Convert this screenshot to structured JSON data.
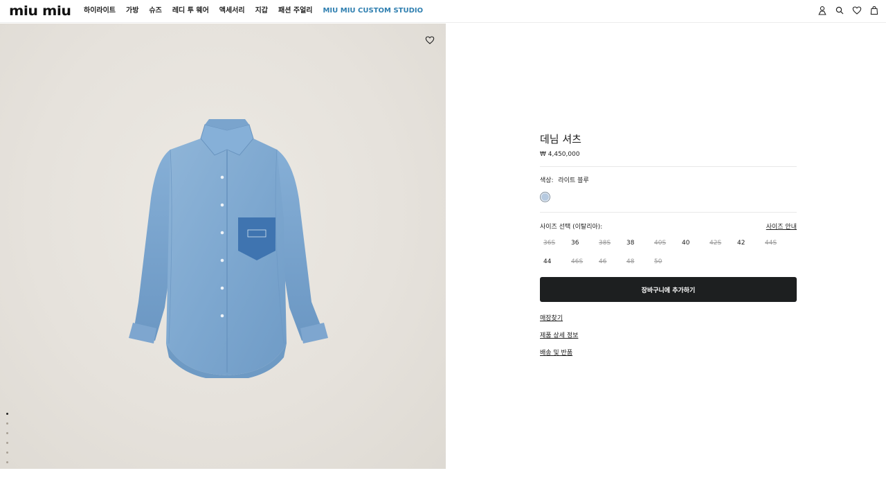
{
  "brand": {
    "logo": "miu miu"
  },
  "nav": [
    "하이라이트",
    "가방",
    "슈즈",
    "레디 투 웨어",
    "액세서리",
    "지갑",
    "패션 주얼리",
    "MIU MIU CUSTOM STUDIO"
  ],
  "header_icons": [
    "user-icon",
    "search-icon",
    "heart-icon",
    "bag-icon"
  ],
  "product": {
    "title": "데님 셔츠",
    "price": "₩ 4,450,000",
    "color_label": "색상:",
    "color_value": "라이트 블루",
    "swatch_color": "#b6cae0",
    "size_label": "사이즈 선택 (이탈리아):",
    "size_guide": "사이즈 안내",
    "sizes": [
      {
        "label": "36S",
        "available": false
      },
      {
        "label": "36",
        "available": true
      },
      {
        "label": "38S",
        "available": false
      },
      {
        "label": "38",
        "available": true
      },
      {
        "label": "40S",
        "available": false
      },
      {
        "label": "40",
        "available": true
      },
      {
        "label": "42S",
        "available": false
      },
      {
        "label": "42",
        "available": true
      },
      {
        "label": "44S",
        "available": false
      },
      {
        "label": "44",
        "available": true
      },
      {
        "label": "46S",
        "available": false
      },
      {
        "label": "46",
        "available": false
      },
      {
        "label": "48",
        "available": false
      },
      {
        "label": "50",
        "available": false
      }
    ],
    "add_to_cart": "장바구니에 추가하기",
    "links": [
      "매장찾기",
      "제품 상세 정보",
      "배송 및 반품"
    ]
  },
  "gallery": {
    "image_count": 6,
    "active_index": 0
  },
  "colors": {
    "accent_nav": "#2f7fb0",
    "button_bg": "#1d1f20",
    "image_bg": "#e8e4de"
  }
}
